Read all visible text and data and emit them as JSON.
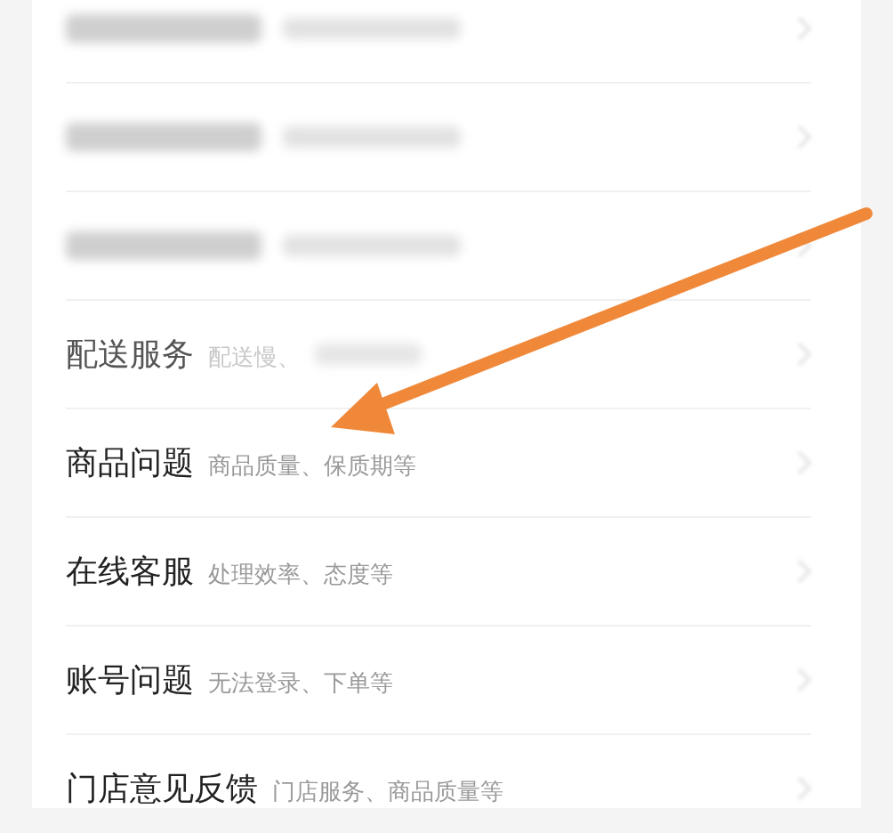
{
  "rows": [
    {
      "kind": "blurred"
    },
    {
      "kind": "blurred"
    },
    {
      "kind": "blurred"
    },
    {
      "kind": "text",
      "title": "配送服务",
      "hint": "配送慢、",
      "faded": true
    },
    {
      "kind": "text",
      "title": "商品问题",
      "hint": "商品质量、保质期等",
      "faded": false
    },
    {
      "kind": "text",
      "title": "在线客服",
      "hint": "处理效率、态度等",
      "faded": false
    },
    {
      "kind": "text",
      "title": "账号问题",
      "hint": "无法登录、下单等",
      "faded": false
    },
    {
      "kind": "text",
      "title": "门店意见反馈",
      "hint": "门店服务、商品质量等",
      "faded": false
    }
  ]
}
